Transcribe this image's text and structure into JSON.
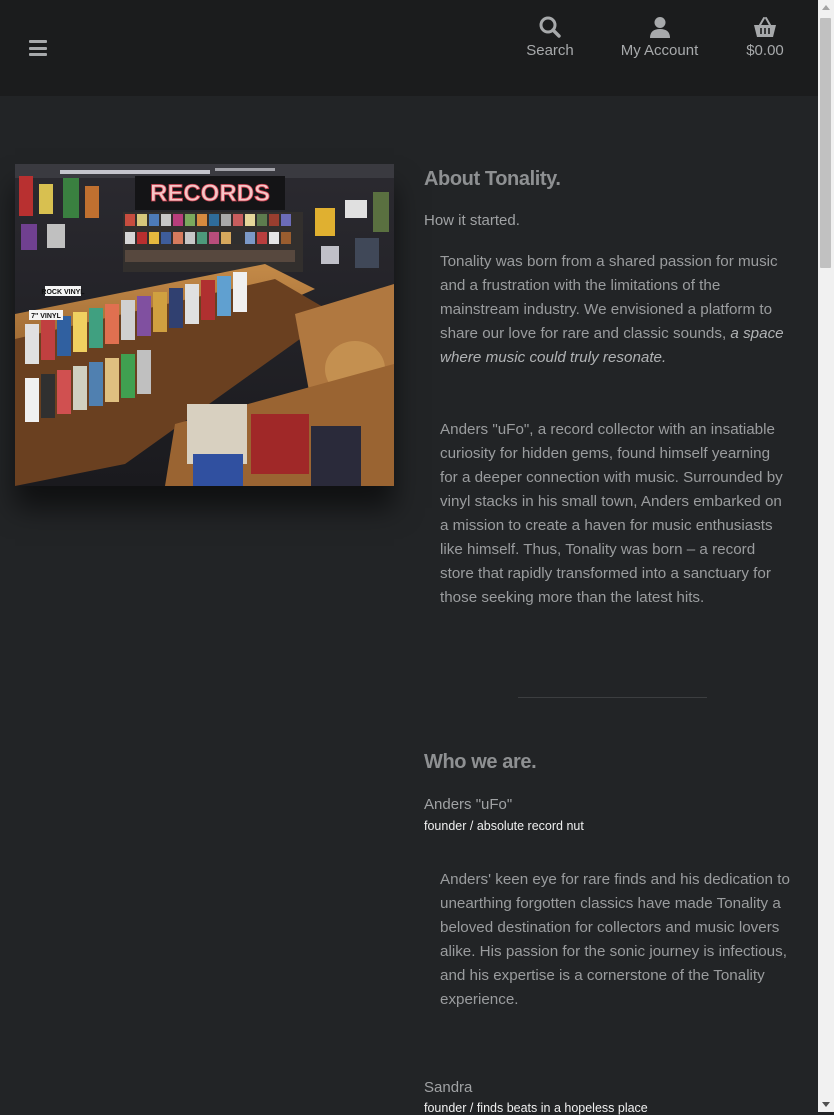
{
  "header": {
    "menu_icon": "hamburger-icon",
    "search": {
      "label": "Search",
      "icon": "search-icon"
    },
    "account": {
      "label": "My Account",
      "icon": "user-icon"
    },
    "cart": {
      "label": "$0.00",
      "icon": "basket-icon"
    }
  },
  "hero_image": {
    "sign_text": "RECORDS",
    "crate_labels": [
      "ROCK VINYL",
      "7\" VINYL"
    ]
  },
  "about": {
    "heading": "About Tonality.",
    "subheading": "How it started.",
    "para1_text": "Tonality was born from a shared passion for music and a frustration with the limitations of the mainstream industry. We envisioned a platform to share our love for rare and classic sounds,",
    "para1_emphasis": "a space where music could truly resonate.",
    "para2_text": "Anders \"uFo\", a record collector with an insatiable curiosity for hidden gems, found himself yearning for a deeper connection with music. Surrounded by vinyl stacks in his small town, Anders embarked on a mission to create a haven for music enthusiasts like himself. Thus, Tonality was born – a record store that rapidly transformed into a sanctuary for those seeking more than the latest hits."
  },
  "team": {
    "heading": "Who we are.",
    "members": [
      {
        "name": "Anders \"uFo\"",
        "role": "founder / absolute record nut",
        "bio": "Anders' keen eye for rare finds and his dedication to unearthing forgotten classics have made Tonality a beloved destination for collectors and music lovers alike. His passion for the sonic journey is infectious, and his expertise is a cornerstone of the Tonality experience."
      },
      {
        "name": "Sandra",
        "role": "founder / finds beats in a hopeless place"
      }
    ]
  },
  "colors": {
    "background": "#222426",
    "header": "#1b1c1d",
    "text": "#9a9c9e"
  }
}
